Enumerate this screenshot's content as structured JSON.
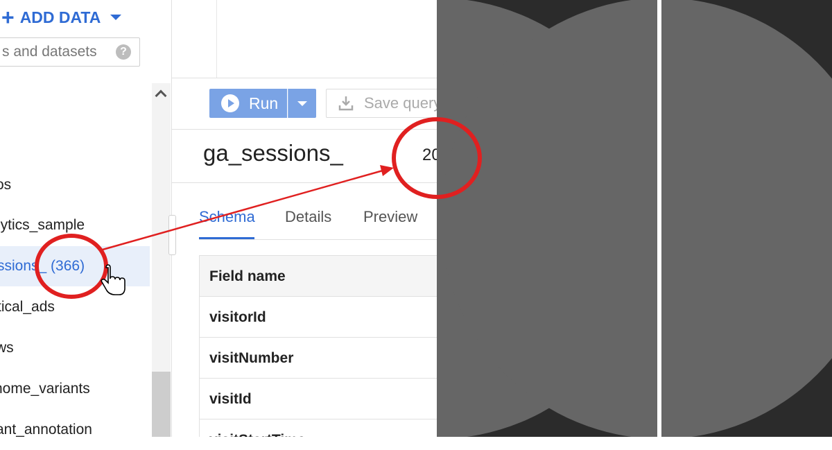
{
  "sidebar": {
    "add_data_label": "ADD DATA",
    "search_placeholder": "s and datasets",
    "help_glyph": "?",
    "items": [
      {
        "label": "os"
      },
      {
        "label": "lytics_sample"
      },
      {
        "label": "ssions_ (366)",
        "selected": true
      },
      {
        "label": "tical_ads"
      },
      {
        "label": "ws"
      },
      {
        "label": "nome_variants"
      },
      {
        "label": "ant_annotation"
      }
    ]
  },
  "toolbar": {
    "run_label": "Run",
    "save_label": "Save query"
  },
  "table": {
    "title": "ga_sessions_",
    "date_partial": "20"
  },
  "tabs": [
    {
      "label": "Schema",
      "active": true
    },
    {
      "label": "Details"
    },
    {
      "label": "Preview"
    }
  ],
  "schema": {
    "header": "Field name",
    "rows": [
      "visitorId",
      "visitNumber",
      "visitId",
      "visitStartTime"
    ]
  },
  "colors": {
    "accent": "#2f6bd4",
    "annotation": "#e02020",
    "right_bg": "#2b2b2b",
    "right_circle": "#666666"
  },
  "icons": [
    "plus-icon",
    "dropdown-caret-icon",
    "help-icon",
    "play-icon",
    "download-icon",
    "chevron-up-icon",
    "hand-cursor-icon"
  ]
}
